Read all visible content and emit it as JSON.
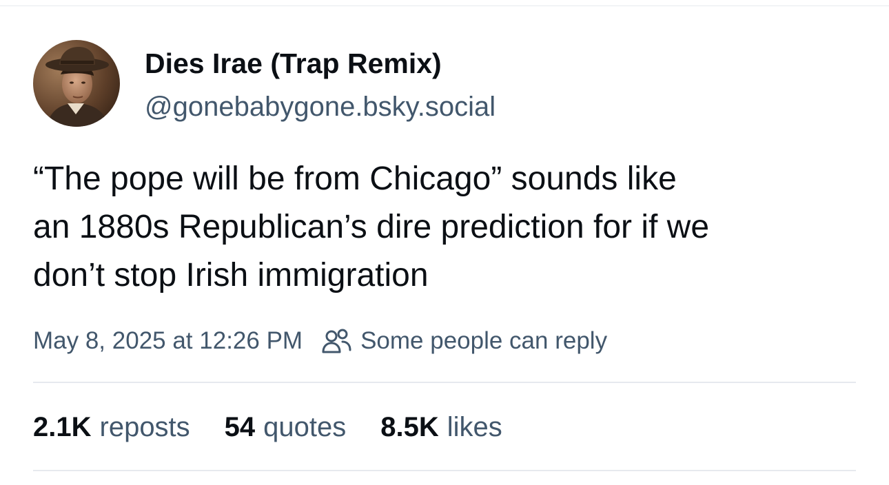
{
  "author": {
    "display_name": "Dies Irae (Trap Remix)",
    "handle": "@gonebabygone.bsky.social",
    "avatar_icon": "avatar-photo-icon"
  },
  "post": {
    "text_lines": [
      "“The pope will be from Chicago” sounds like",
      "an 1880s Republican’s dire prediction for if we",
      "don’t stop Irish immigration"
    ],
    "timestamp": "May 8, 2025 at 12:26 PM",
    "reply_setting": "Some people can reply",
    "reply_setting_icon": "people-icon"
  },
  "stats": {
    "reposts_count": "2.1K",
    "reposts_label": "reposts",
    "quotes_count": "54",
    "quotes_label": "quotes",
    "likes_count": "8.5K",
    "likes_label": "likes"
  },
  "colors": {
    "text_primary": "#0b0f14",
    "text_secondary": "#42576c",
    "divider": "#e6e9ee",
    "background": "#ffffff"
  }
}
